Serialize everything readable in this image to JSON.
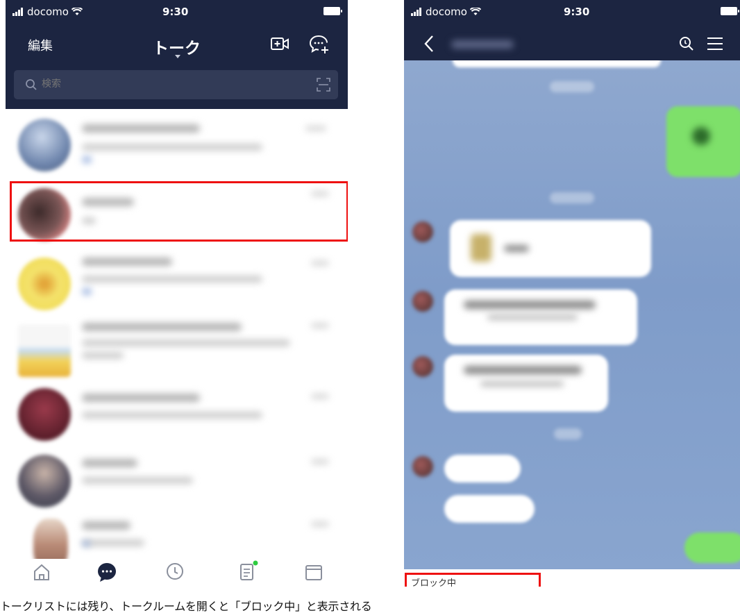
{
  "left_screen": {
    "status": {
      "carrier": "docomo",
      "time": "9:30"
    },
    "topbar": {
      "edit_label": "編集",
      "title": "トーク"
    },
    "search": {
      "placeholder": "検索"
    },
    "chats": [
      {
        "avatar_color": "#8fa2c4"
      },
      {
        "avatar_color": "#6b4a4a",
        "highlighted": true
      },
      {
        "avatar_color": "#f2d23a"
      },
      {
        "avatar_color": "#d6c9a0"
      },
      {
        "avatar_color": "#7a2838"
      },
      {
        "avatar_color": "#5e5a68"
      },
      {
        "avatar_color": "#c9a087"
      }
    ],
    "tabs": [
      "home-icon",
      "chat-icon",
      "timeline-icon",
      "news-icon",
      "wallet-icon"
    ],
    "active_tab": "chat-icon",
    "news_badge_color": "#2ecc40"
  },
  "right_screen": {
    "status": {
      "carrier": "docomo",
      "time": "9:30"
    },
    "blocked_label": "ブロック中"
  },
  "caption": "トークリストには残り、トークルームを開くと「ブロック中」と表示される",
  "colors": {
    "header_navy": "#1c2541",
    "highlight_red": "#ee1111",
    "chat_bg_blue": "#86a2cc",
    "bubble_green": "#7ee06a"
  }
}
